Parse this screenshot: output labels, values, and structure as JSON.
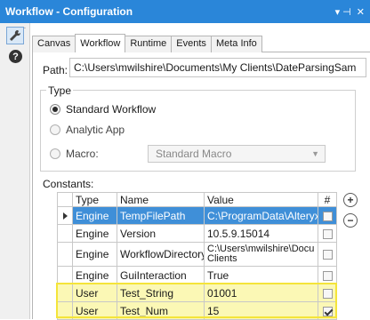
{
  "window": {
    "title": "Workflow - Configuration",
    "pin_glyph": "▾ ⊣",
    "close_glyph": "✕"
  },
  "toolbar": {
    "dots": "· · ·",
    "help_glyph": "?"
  },
  "tabs": [
    {
      "label": "Canvas",
      "active": false
    },
    {
      "label": "Workflow",
      "active": true
    },
    {
      "label": "Runtime",
      "active": false
    },
    {
      "label": "Events",
      "active": false
    },
    {
      "label": "Meta Info",
      "active": false
    }
  ],
  "path": {
    "label": "Path:",
    "value": "C:\\Users\\mwilshire\\Documents\\My Clients\\DateParsingSam"
  },
  "type_group": {
    "legend": "Type",
    "options": [
      {
        "label": "Standard Workflow",
        "selected": true
      },
      {
        "label": "Analytic App",
        "selected": false
      },
      {
        "label": "Macro:",
        "selected": false
      }
    ],
    "macro_select": "Standard Macro"
  },
  "constants": {
    "label": "Constants:",
    "columns": [
      "Type",
      "Name",
      "Value",
      "#"
    ],
    "rows": [
      {
        "type": "Engine",
        "name": "TempFilePath",
        "value": "C:\\ProgramData\\Alteryx\\",
        "checked": false
      },
      {
        "type": "Engine",
        "name": "Version",
        "value": "10.5.9.15014",
        "checked": false
      },
      {
        "type": "Engine",
        "name": "WorkflowDirectory",
        "value": "C:\\Users\\mwilshire\\Docu Clients",
        "checked": false
      },
      {
        "type": "Engine",
        "name": "GuiInteraction",
        "value": "True",
        "checked": false
      },
      {
        "type": "User",
        "name": "Test_String",
        "value": "01001",
        "checked": false
      },
      {
        "type": "User",
        "name": "Test_Num",
        "value": "15",
        "checked": true
      }
    ]
  },
  "buttons": {
    "add": "+",
    "remove": "−"
  },
  "colors": {
    "titlebar": "#2a86d9",
    "selected_row": "#3f8fd8",
    "highlight": "#fbf8b5",
    "highlight_border": "#f4e43a"
  }
}
